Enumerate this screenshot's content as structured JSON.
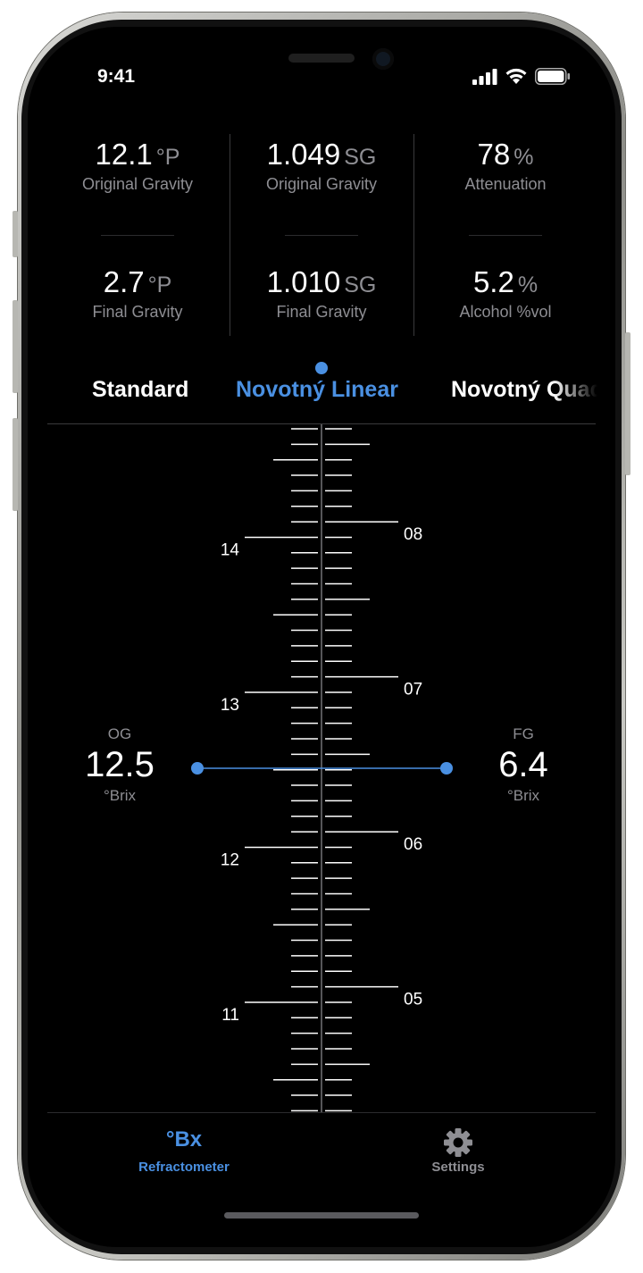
{
  "status": {
    "time": "9:41"
  },
  "summary": {
    "og_plato": {
      "value": "12.1",
      "unit": "°P",
      "label": "Original Gravity"
    },
    "og_sg": {
      "value": "1.049",
      "unit": "SG",
      "label": "Original Gravity"
    },
    "attenuation": {
      "value": "78",
      "unit": "%",
      "label": "Attenuation"
    },
    "fg_plato": {
      "value": "2.7",
      "unit": "°P",
      "label": "Final Gravity"
    },
    "fg_sg": {
      "value": "1.010",
      "unit": "SG",
      "label": "Final Gravity"
    },
    "abv": {
      "value": "5.2",
      "unit": "%",
      "label": "Alcohol %vol"
    }
  },
  "formula_tabs": [
    {
      "label": "Standard",
      "selected": false
    },
    {
      "label": "Novotný Linear",
      "selected": true
    },
    {
      "label": "Novotný Quadratic",
      "selected": false
    }
  ],
  "scale": {
    "og": {
      "caption": "OG",
      "value": "12.5",
      "unit": "°Brix"
    },
    "fg": {
      "caption": "FG",
      "value": "6.4",
      "unit": "°Brix"
    },
    "left_labels": [
      "14",
      "13",
      "12",
      "11"
    ],
    "right_labels": [
      "08",
      "07",
      "06",
      "05"
    ]
  },
  "tabbar": {
    "refractometer": {
      "icon_text": "°Bx",
      "label": "Refractometer",
      "selected": true
    },
    "settings": {
      "label": "Settings",
      "selected": false
    }
  },
  "colors": {
    "accent": "#4a90e2",
    "background": "#000000",
    "secondary_text": "#8e8e93"
  }
}
